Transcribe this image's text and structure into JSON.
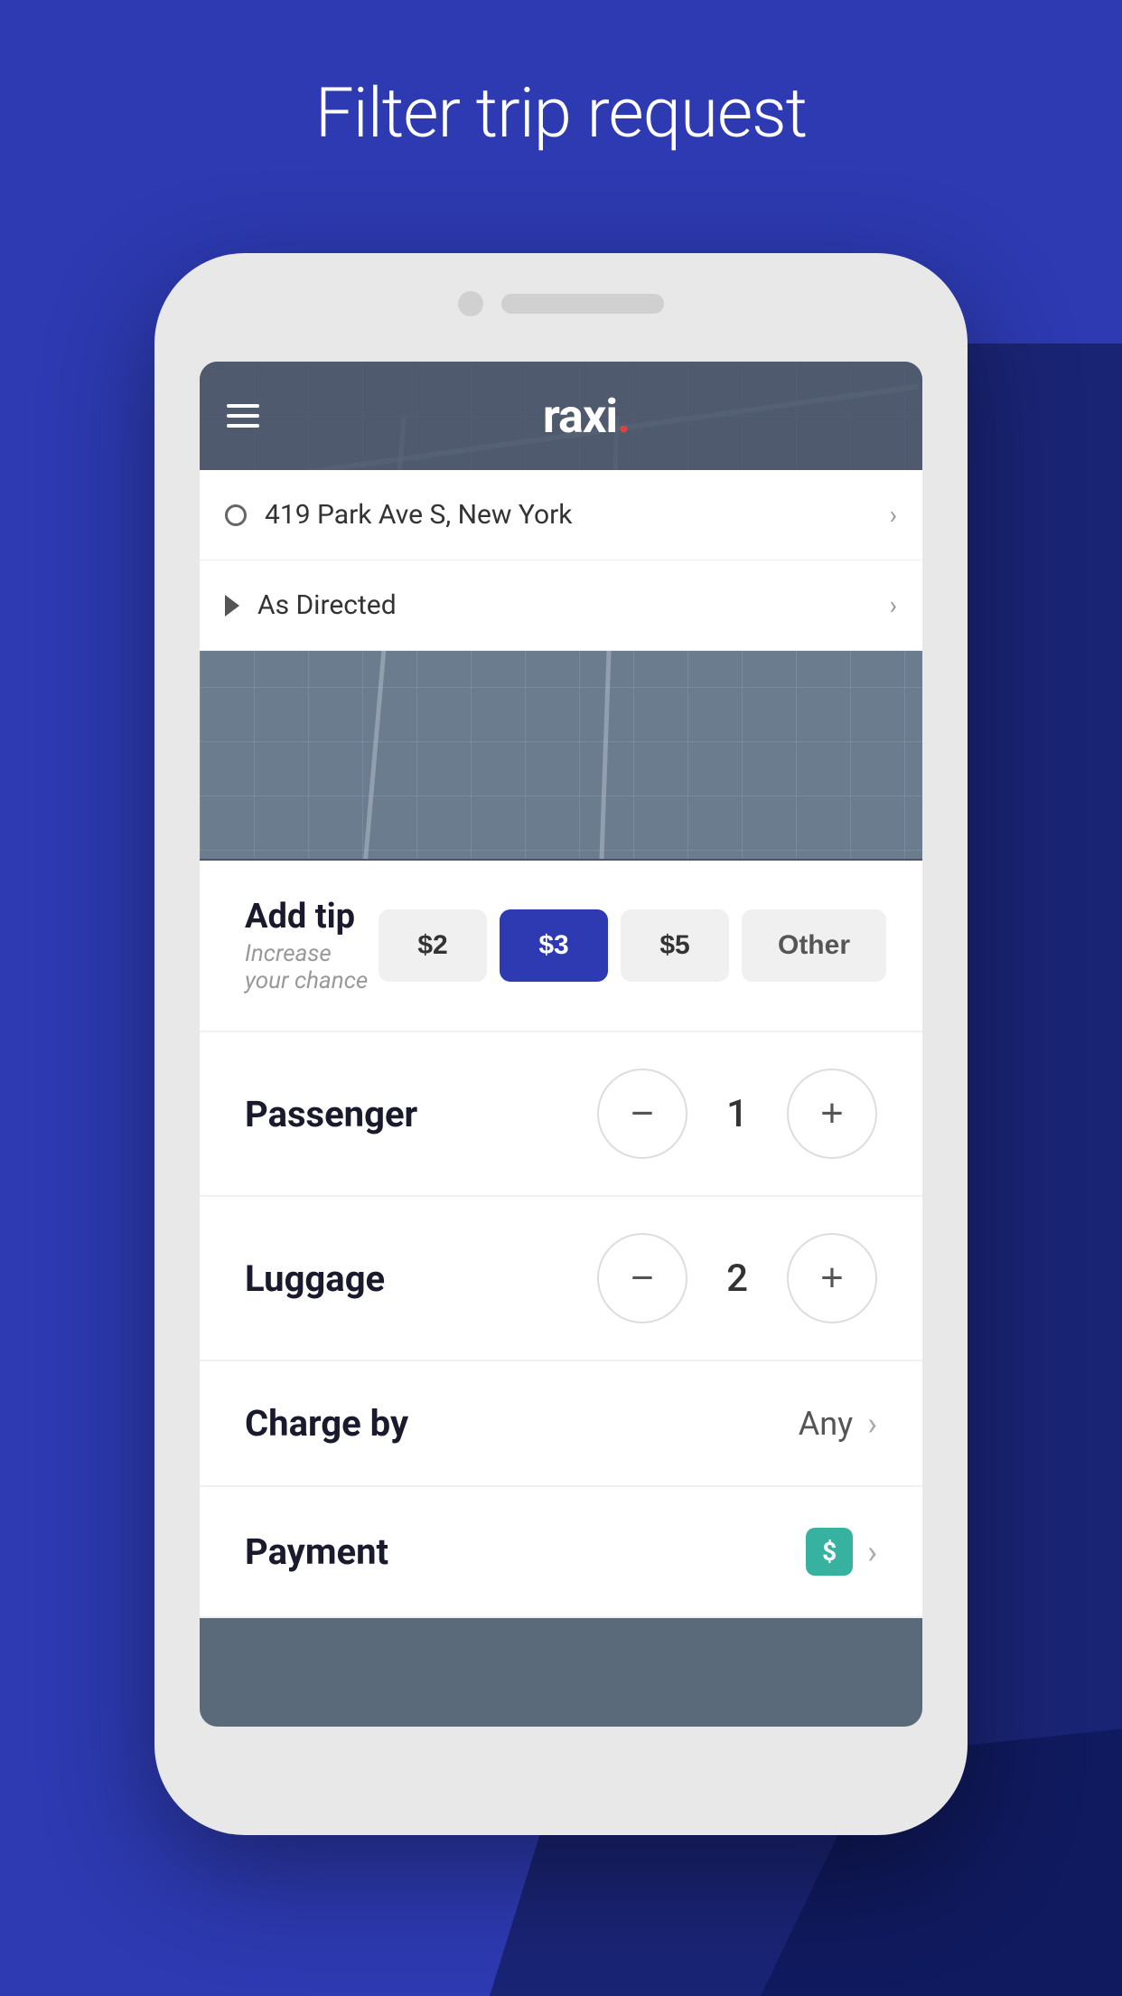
{
  "page": {
    "title": "Filter trip request",
    "background_color": "#2d3ab1"
  },
  "app": {
    "logo": "raxi",
    "logo_dot_color": "#e53e3e",
    "header_menu_icon": "hamburger"
  },
  "map": {
    "origin": "419 Park Ave S, New York",
    "destination": "As Directed"
  },
  "tip_section": {
    "label": "Add tip",
    "sublabel": "Increase your chance",
    "buttons": [
      {
        "label": "$2",
        "active": false
      },
      {
        "label": "$3",
        "active": true
      },
      {
        "label": "$5",
        "active": false
      },
      {
        "label": "Other",
        "active": false
      }
    ]
  },
  "passenger": {
    "label": "Passenger",
    "value": "1",
    "decrement": "−",
    "increment": "+"
  },
  "luggage": {
    "label": "Luggage",
    "value": "2",
    "decrement": "−",
    "increment": "+"
  },
  "charge_by": {
    "label": "Charge by",
    "value": "Any",
    "chevron": "›"
  },
  "payment": {
    "label": "Payment",
    "icon_bg": "#38b2a0",
    "icon_symbol": "$",
    "chevron": "›"
  }
}
